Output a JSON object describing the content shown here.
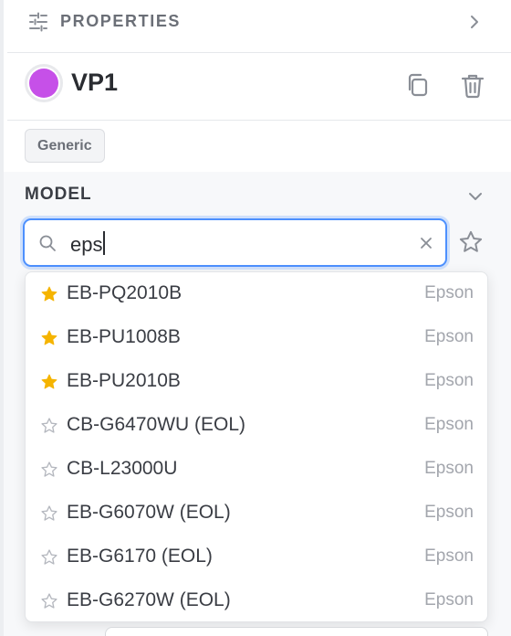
{
  "header": {
    "title": "PROPERTIES",
    "icons": [
      "sliders-icon",
      "chevron-right-icon"
    ]
  },
  "item": {
    "name": "VP1",
    "color": "#c650e8",
    "actions": [
      "duplicate-icon",
      "trash-icon"
    ]
  },
  "tag": "Generic",
  "model": {
    "label": "MODEL",
    "search_value": "eps",
    "options": [
      {
        "name": "EB-PQ2010B",
        "brand": "Epson",
        "favorite": true
      },
      {
        "name": "EB-PU1008B",
        "brand": "Epson",
        "favorite": true
      },
      {
        "name": "EB-PU2010B",
        "brand": "Epson",
        "favorite": true
      },
      {
        "name": "CB-G6470WU (EOL)",
        "brand": "Epson",
        "favorite": false
      },
      {
        "name": "CB-L23000U",
        "brand": "Epson",
        "favorite": false
      },
      {
        "name": "EB-G6070W (EOL)",
        "brand": "Epson",
        "favorite": false
      },
      {
        "name": "EB-G6170 (EOL)",
        "brand": "Epson",
        "favorite": false
      },
      {
        "name": "EB-G6270W (EOL)",
        "brand": "Epson",
        "favorite": false
      }
    ]
  },
  "colors": {
    "accent": "#4d90fe",
    "star_filled": "#f5b400",
    "swatch": "#c650e8"
  }
}
